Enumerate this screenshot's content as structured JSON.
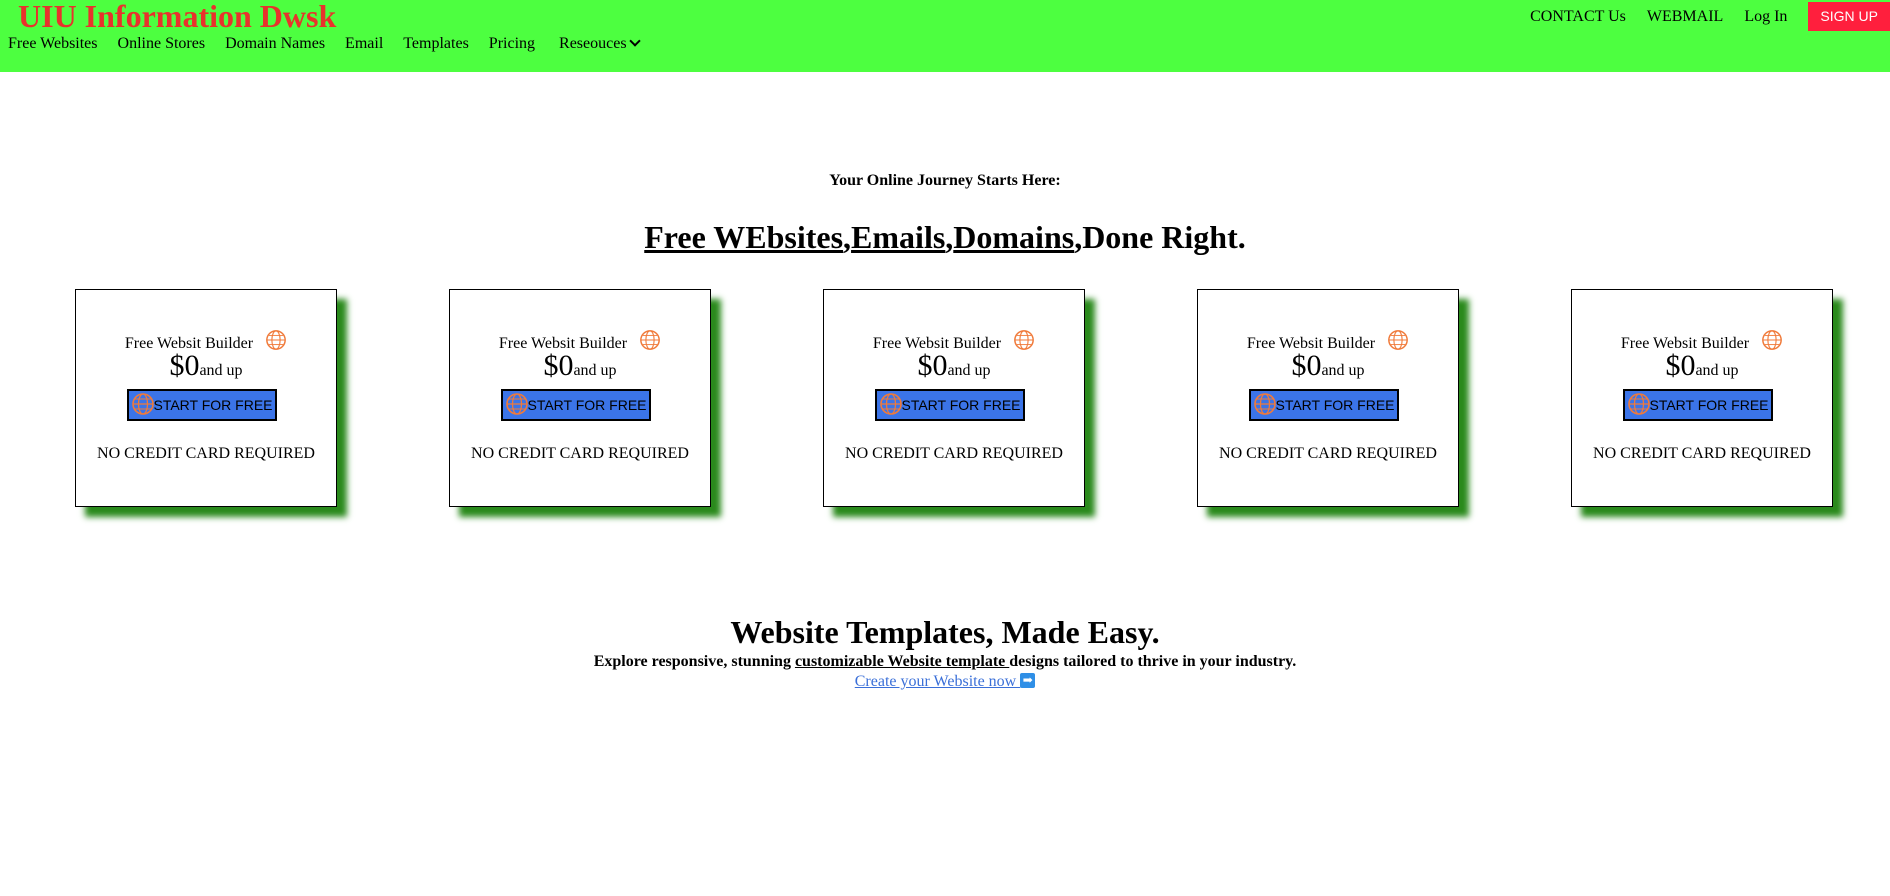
{
  "header": {
    "brand": "UIU Information Dwsk",
    "nav": [
      "Free Websites",
      "Online Stores",
      "Domain Names",
      "Email",
      "Templates",
      "Pricing"
    ],
    "resources_label": "Reseouces",
    "contact": "CONTACT Us",
    "webmail": "WEBMAIL",
    "login": "Log In",
    "signup": "SIGN UP"
  },
  "hero": {
    "kicker": "Your Online Journey Starts Here:",
    "headline_parts": [
      "Free WEbsites",
      ",",
      "Emails",
      ",",
      "Domains",
      ",Done Right."
    ]
  },
  "cards": [
    {
      "title": "Free Websit Builder",
      "price": "$0",
      "price_suffix": "and up",
      "button": "START FOR FREE",
      "note": "NO CREDIT CARD REQUIRED"
    },
    {
      "title": "Free Websit Builder",
      "price": "$0",
      "price_suffix": "and up",
      "button": "START FOR FREE",
      "note": "NO CREDIT CARD REQUIRED"
    },
    {
      "title": "Free Websit Builder",
      "price": "$0",
      "price_suffix": "and up",
      "button": "START FOR FREE",
      "note": "NO CREDIT CARD REQUIRED"
    },
    {
      "title": "Free Websit Builder",
      "price": "$0",
      "price_suffix": "and up",
      "button": "START FOR FREE",
      "note": "NO CREDIT CARD REQUIRED"
    },
    {
      "title": "Free Websit Builder",
      "price": "$0",
      "price_suffix": "and up",
      "button": "START FOR FREE",
      "note": "NO CREDIT CARD REQUIRED"
    }
  ],
  "templates": {
    "title": "Website Templates, Made Easy.",
    "sub_pre": "Explore responsive, stunning ",
    "sub_link": "customizable Website template ",
    "sub_post": "designs tailored to thrive in your industry.",
    "cta": "Create your Website now ",
    "cta_icon": "➡"
  },
  "colors": {
    "header_bg": "#4dff40",
    "brand": "#e8322c",
    "signup_bg": "#ff1f3d",
    "button_bg": "#3b74e8",
    "card_shadow": "#2a8a1c",
    "globe_icon": "#f07a3a",
    "link": "#3a6fd8"
  },
  "icons": {
    "globe": "globe-www-icon",
    "chevron": "chevron-down-icon",
    "arrow": "arrow-right-icon"
  }
}
